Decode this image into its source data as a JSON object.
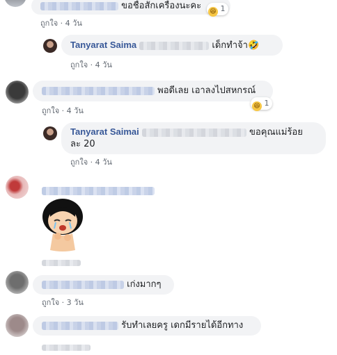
{
  "common": {
    "like": "ถูกใจ",
    "dot": "·",
    "react_emoji": "😆"
  },
  "comment1": {
    "text": "ขอชื่อสักเครื่องนะคะ",
    "time": "4 วัน",
    "react_count": "1"
  },
  "reply1": {
    "name": "Tanyarat Saima",
    "text": "เด็กทำจ้า🤣",
    "time": "4 วัน"
  },
  "comment2": {
    "text": "พอดีเลย เอาลงไปสหกรณ์",
    "time": "4 วัน",
    "react_count": "1"
  },
  "reply2": {
    "name": "Tanyarat Saimai",
    "text_line1": "ขอคุณแม่ร้อย",
    "text_line2": "ละ 20",
    "time": "4 วัน"
  },
  "comment3": {
    "sticker": "crying-girl-sticker"
  },
  "comment4": {
    "text": "เก่งมากๆ",
    "time": "3 วัน"
  },
  "comment5": {
    "text": "รับทำเลยครู เดกมีรายได้อีกทาง"
  }
}
